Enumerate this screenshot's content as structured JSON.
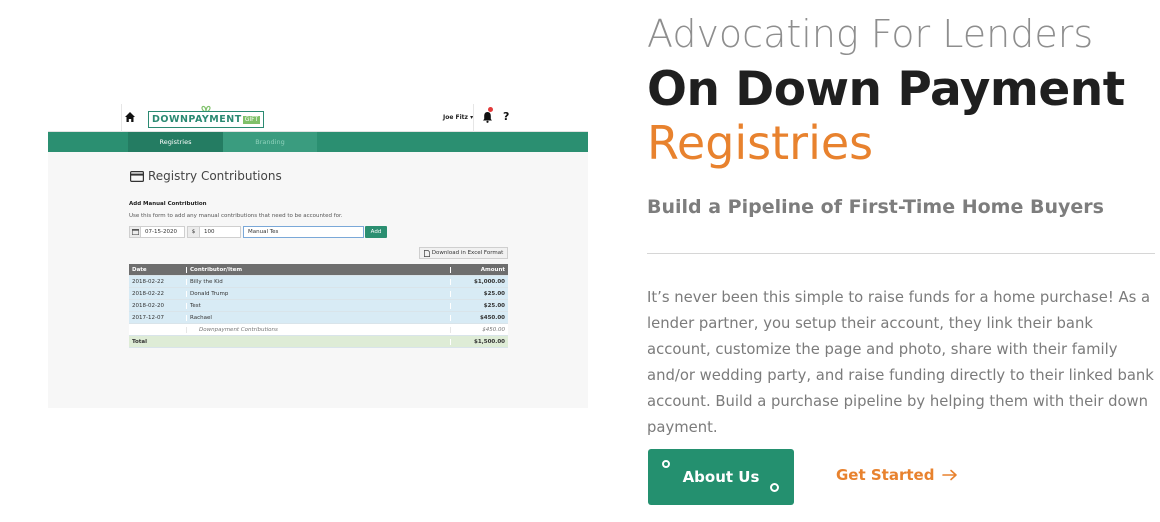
{
  "app": {
    "logo_text": "DOWNPAYMENT",
    "logo_badge": "GIFT",
    "user_menu": "Joe Fitz ▾",
    "help_glyph": "?",
    "nav_tabs": [
      {
        "label": "Registries",
        "active": true
      },
      {
        "label": "Branding",
        "active": false
      }
    ],
    "page_title": "Registry Contributions",
    "form": {
      "title": "Add Manual Contribution",
      "help": "Use this form to add any manual contributions that need to be accounted for.",
      "date_value": "07-15-2020",
      "currency_symbol": "$",
      "amount_value": "100",
      "name_value": "Manual Tes",
      "add_label": "Add"
    },
    "download_label": "Download in Excel Format",
    "table": {
      "headers": [
        "Date",
        "Contributor/Item",
        "Amount"
      ],
      "rows": [
        {
          "date": "2018-02-22",
          "name": "Billy the Kid",
          "amount": "$1,000.00"
        },
        {
          "date": "2018-02-22",
          "name": "Donald Trump",
          "amount": "$25.00"
        },
        {
          "date": "2018-02-20",
          "name": "Test",
          "amount": "$25.00"
        },
        {
          "date": "2017-12-07",
          "name": "Rachael",
          "amount": "$450.00"
        }
      ],
      "sub_row": {
        "name": "Downpayment Contributions",
        "amount": "$450.00"
      },
      "total_row": {
        "label": "Total",
        "amount": "$1,500.00"
      }
    },
    "colors": {
      "brand_green": "#2b8f71",
      "badge_green": "#7fc16a",
      "notification_red": "#e23b3b"
    },
    "icons": [
      "home-icon",
      "bell-icon",
      "calendar-icon",
      "credit-card-icon",
      "file-icon"
    ]
  },
  "hero": {
    "eyebrow": "Advocating For Lenders",
    "headline": "On Down Payment",
    "accent": "Registries",
    "subhead": "Build a Pipeline of First-Time Home Buyers",
    "body": "It’s never been this simple to raise funds for a home purchase! As a lender partner, you setup their account, they link their bank account, customize the page and photo, share with their family and/or wedding party, and raise funding directly to their linked bank account. Build a purchase pipeline by helping them with their down payment.",
    "about_label": "About Us",
    "started_label": "Get Started",
    "colors": {
      "accent_orange": "#e8822e",
      "button_green": "#24906f",
      "headline": "#1f1f1f",
      "muted": "#8e8e8e"
    }
  }
}
